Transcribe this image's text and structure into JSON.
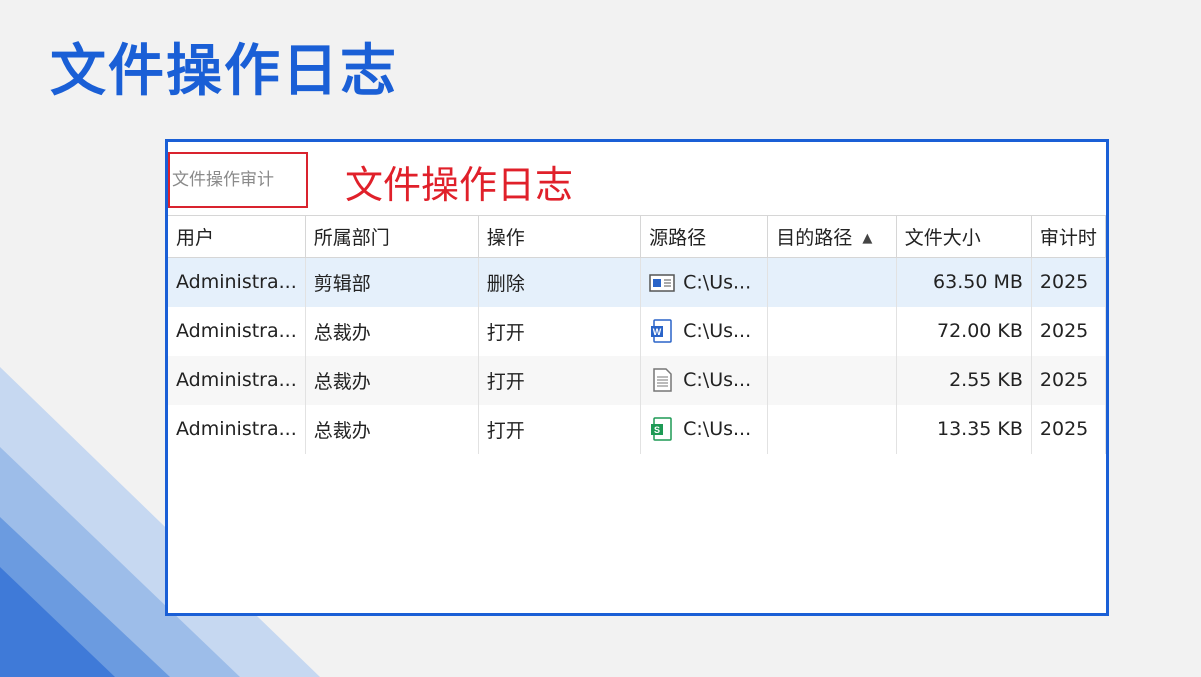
{
  "slide": {
    "title": "文件操作日志"
  },
  "window": {
    "audit_tab_label": "文件操作审计",
    "annotation": "文件操作日志"
  },
  "table": {
    "columns": [
      "用户",
      "所属部门",
      "操作",
      "源路径",
      "目的路径",
      "文件大小",
      "审计时"
    ],
    "sort_column_index": 4,
    "sort_direction": "ascending",
    "rows": [
      {
        "user": "Administra...",
        "dept": "剪辑部",
        "op": "删除",
        "src": "C:\\Us...",
        "src_icon": "generic-file-icon",
        "dst": "",
        "size": "63.50 MB",
        "time": "2025"
      },
      {
        "user": "Administra...",
        "dept": "总裁办",
        "op": "打开",
        "src": "C:\\Us...",
        "src_icon": "word-doc-icon",
        "dst": "",
        "size": "72.00 KB",
        "time": "2025"
      },
      {
        "user": "Administra...",
        "dept": "总裁办",
        "op": "打开",
        "src": "C:\\Us...",
        "src_icon": "text-file-icon",
        "dst": "",
        "size": "2.55 KB",
        "time": "2025"
      },
      {
        "user": "Administra...",
        "dept": "总裁办",
        "op": "打开",
        "src": "C:\\Us...",
        "src_icon": "spreadsheet-icon",
        "dst": "",
        "size": "13.35 KB",
        "time": "2025"
      }
    ]
  },
  "colors": {
    "title_blue": "#1a5fd6",
    "annotation_red": "#e0202a",
    "selected_row": "#e5f0fb"
  }
}
